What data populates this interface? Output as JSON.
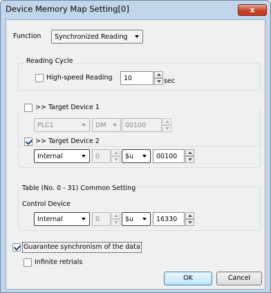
{
  "window": {
    "title": "Device Memory Map Setting[0]",
    "close_label": "x"
  },
  "function": {
    "label": "Function",
    "value": "Synchronized Reading"
  },
  "reading_cycle": {
    "group_label": "Reading Cycle",
    "high_speed_label": "High-speed Reading",
    "high_speed_checked": false,
    "value": "10",
    "unit": "sec"
  },
  "target_device_1": {
    "label": ">> Target Device 1",
    "checked": false,
    "plc": "PLC1",
    "device": "DM",
    "address": "00100"
  },
  "target_device_2": {
    "label": ">> Target Device 2",
    "checked": true,
    "type": "Internal",
    "index": "0",
    "device": "$u",
    "address": "00100"
  },
  "common_setting": {
    "group_label": "Table (No. 0 - 31) Common Setting",
    "control_device_label": "Control Device",
    "type": "Internal",
    "index": "0",
    "device": "$u",
    "address": "16330"
  },
  "guarantee_sync": {
    "label": "Guarantee synchronism of the data",
    "checked": true
  },
  "infinite_retrials": {
    "label": "Infinite retrials",
    "checked": false
  },
  "buttons": {
    "ok": "OK",
    "cancel": "Cancel"
  }
}
